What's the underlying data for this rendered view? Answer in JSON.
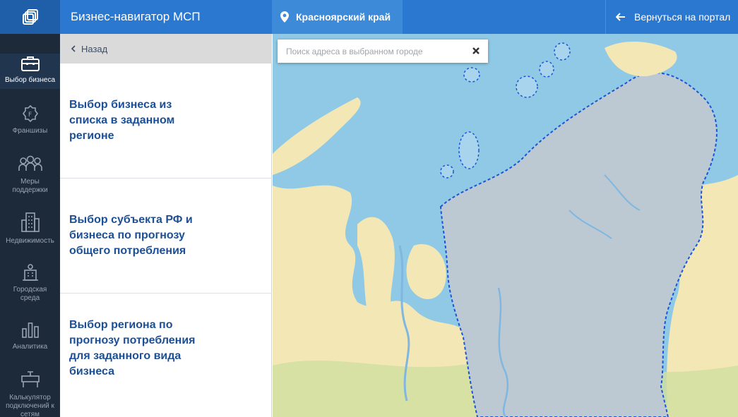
{
  "header": {
    "app_title": "Бизнес-навигатор МСП",
    "region": "Красноярский край",
    "back_to_portal": "Вернуться на портал"
  },
  "nav": {
    "items": [
      {
        "label": "Выбор бизнеса",
        "icon": "briefcase-icon",
        "active": true
      },
      {
        "label": "Франшизы",
        "icon": "franchise-badge-icon",
        "active": false
      },
      {
        "label": "Меры поддержки",
        "icon": "people-group-icon",
        "active": false
      },
      {
        "label": "Недвижимость",
        "icon": "building-icon",
        "active": false
      },
      {
        "label": "Городская среда",
        "icon": "city-icon",
        "active": false
      },
      {
        "label": "Аналитика",
        "icon": "bar-chart-icon",
        "active": false
      },
      {
        "label": "Калькулятор подключений к сетям",
        "icon": "pipe-valve-icon",
        "active": false
      }
    ]
  },
  "panel": {
    "back_label": "Назад",
    "options": [
      {
        "label": "Выбор бизнеса из списка в заданном регионе"
      },
      {
        "label": "Выбор субъекта РФ и бизнеса по прогнозу общего потребления"
      },
      {
        "label": "Выбор региона по прогнозу потребления для заданного вида бизнеса"
      }
    ]
  },
  "map": {
    "search_placeholder": "Поиск адреса в выбранном городе",
    "search_value": "",
    "colors": {
      "sea": "#8fc9e6",
      "land": "#f3e7b6",
      "region_fill": "#bcc9d3",
      "border": "#1a55d8"
    }
  }
}
